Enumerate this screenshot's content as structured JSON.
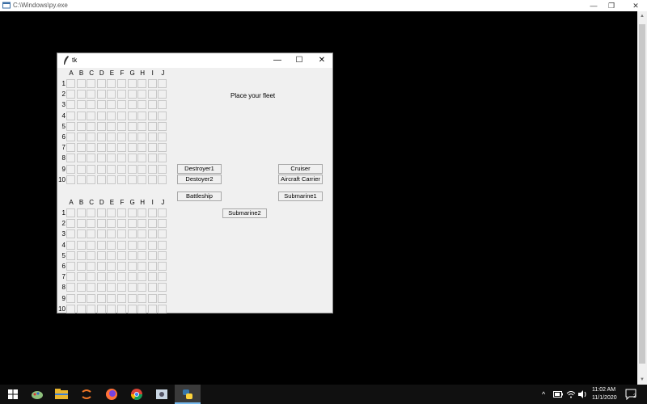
{
  "console": {
    "title": "C:\\Windows\\py.exe",
    "controls": {
      "minimize": "—",
      "restore": "❐",
      "close": "✕"
    }
  },
  "tk": {
    "title": "tk",
    "controls": {
      "minimize": "—",
      "maximize": "☐",
      "close": "✕"
    },
    "columns": [
      "A",
      "B",
      "C",
      "D",
      "E",
      "F",
      "G",
      "H",
      "I",
      "J"
    ],
    "rows": [
      "1",
      "2",
      "3",
      "4",
      "5",
      "6",
      "7",
      "8",
      "9",
      "10"
    ],
    "status": "Place your fleet",
    "ships": {
      "destroyer1": "Destroyer1",
      "destroyer2": "Destoyer2",
      "battleship": "Battleship",
      "cruiser": "Cruiser",
      "aircraft_carrier": "Aircraft Carrier",
      "submarine1": "Submarine1",
      "submarine2": "Submarine2"
    }
  },
  "taskbar": {
    "time": "11:02 AM",
    "date": "11/1/2020",
    "notification_count": "2",
    "chevron": "^"
  }
}
